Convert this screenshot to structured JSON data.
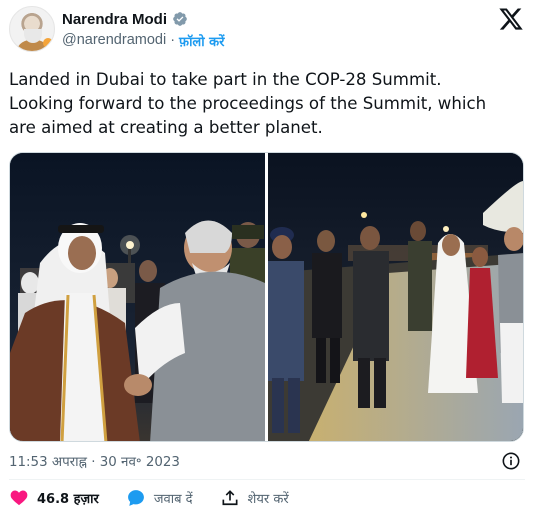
{
  "author": {
    "name": "Narendra Modi",
    "handle": "@narendramodi",
    "separator": "·",
    "follow_label": "फ़ॉलो करें"
  },
  "tweet": {
    "lines": [
      "Landed in Dubai to take part in the COP-28 Summit.",
      "Looking forward to the proceedings of the Summit, which",
      "are aimed at creating a better planet."
    ]
  },
  "media": {
    "count": 2
  },
  "meta": {
    "timestamp": "11:53 अपराह्न · 30 नव॰ 2023"
  },
  "actions": {
    "likes": "46.8 हज़ार",
    "reply_label": "जवाब दें",
    "share_label": "शेयर करें"
  },
  "icons": {
    "verified": "verified-badge-icon",
    "x_logo": "x-logo-icon",
    "info": "info-icon",
    "heart": "heart-icon",
    "reply": "reply-bubble-icon",
    "share": "share-upload-icon"
  },
  "colors": {
    "link_blue": "#1d9bf0",
    "like_red": "#f91880",
    "secondary_text": "#536471",
    "primary_text": "#0f1419"
  }
}
